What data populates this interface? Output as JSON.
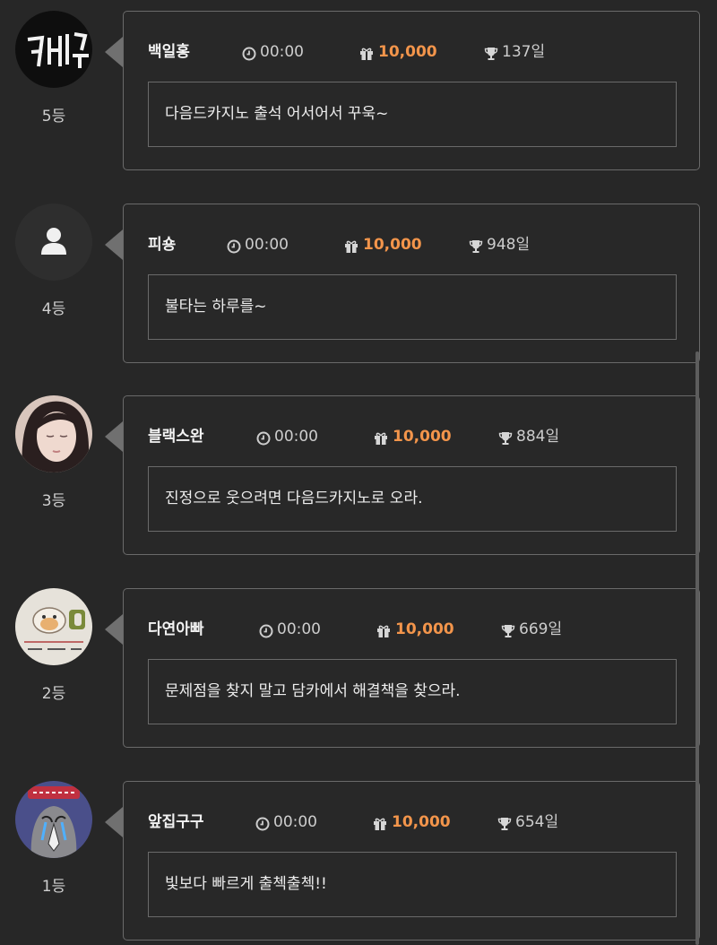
{
  "entries": [
    {
      "name": "백일홍",
      "time": "00:00",
      "points": "10,000",
      "days": "137일",
      "rank": "5등",
      "message": "다음드카지노 출석 어서어서 꾸욱~",
      "avatar": "neon-sign-avatar"
    },
    {
      "name": "피숑",
      "time": "00:00",
      "points": "10,000",
      "days": "948일",
      "rank": "4등",
      "message": "불타는 하루를~",
      "avatar": "default-user-avatar"
    },
    {
      "name": "블랙스완",
      "time": "00:00",
      "points": "10,000",
      "days": "884일",
      "rank": "3등",
      "message": "진정으로 웃으려면 다음드카지노로 오라.",
      "avatar": "portrait-avatar"
    },
    {
      "name": "다연아빠",
      "time": "00:00",
      "points": "10,000",
      "days": "669일",
      "rank": "2등",
      "message": "문제점을 찾지 말고 담카에서 해결책을 찾으라.",
      "avatar": "hamster-avatar"
    },
    {
      "name": "앞집구구",
      "time": "00:00",
      "points": "10,000",
      "days": "654일",
      "rank": "1등",
      "message": "빛보다 빠르게 출첵출첵!!",
      "avatar": "cartoon-bird-avatar"
    }
  ],
  "colors": {
    "accent": "#f3954b",
    "background": "#272727",
    "border": "#6a6a6a"
  },
  "icons": {
    "time": "clock-icon",
    "points": "gift-icon",
    "days": "trophy-icon"
  }
}
